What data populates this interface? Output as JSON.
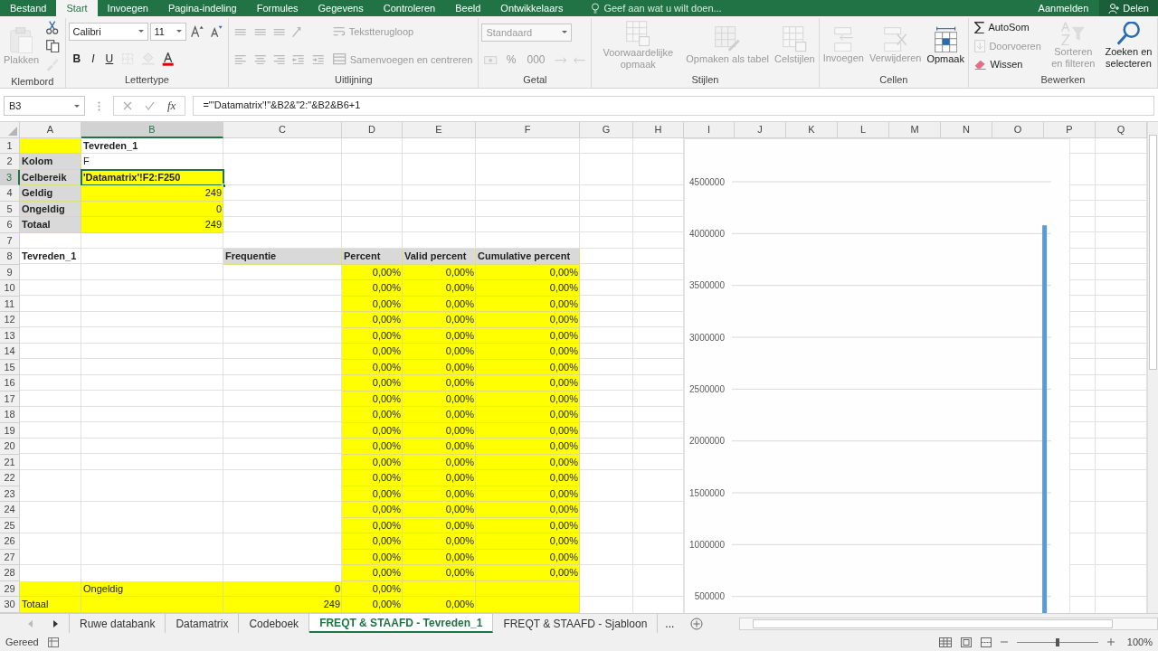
{
  "menu_tabs": [
    {
      "label": "Bestand",
      "selected": false
    },
    {
      "label": "Start",
      "selected": true
    },
    {
      "label": "Invoegen",
      "selected": false
    },
    {
      "label": "Pagina-indeling",
      "selected": false
    },
    {
      "label": "Formules",
      "selected": false
    },
    {
      "label": "Gegevens",
      "selected": false
    },
    {
      "label": "Controleren",
      "selected": false
    },
    {
      "label": "Beeld",
      "selected": false
    },
    {
      "label": "Ontwikkelaars",
      "selected": false
    }
  ],
  "tell_me": {
    "placeholder": "Geef aan wat u wilt doen..."
  },
  "account": {
    "sign_in": "Aanmelden",
    "share": "Delen"
  },
  "ribbon": [
    {
      "label": "Klembord",
      "sections": [
        [
          [
            {
              "kind": "big",
              "label": "Plakken",
              "disabled": true
            }
          ]
        ],
        [
          [
            {
              "kind": "icon",
              "disabled": false
            }
          ],
          [
            {
              "kind": "icon",
              "disabled": false
            }
          ],
          [
            {
              "kind": "icon",
              "disabled": true
            }
          ]
        ]
      ]
    },
    {
      "label": "Lettertype",
      "sections": [
        [
          [
            {
              "kind": "field",
              "value": "Calibri",
              "disabled": false
            },
            {
              "kind": "field",
              "value": "11",
              "disabled": false
            },
            {
              "kind": "icon",
              "disabled": false
            },
            {
              "kind": "icon",
              "disabled": false
            }
          ],
          [
            {
              "kind": "bold",
              "label": "B",
              "disabled": false
            },
            {
              "kind": "italic",
              "label": "I",
              "disabled": false
            },
            {
              "kind": "underline",
              "label": "U",
              "disabled": false
            },
            {
              "kind": "icon",
              "disabled": true
            },
            {
              "kind": "icon",
              "disabled": true
            },
            {
              "kind": "icon",
              "disabled": false
            }
          ]
        ]
      ]
    },
    {
      "label": "Uitlijning",
      "sections": [
        [
          [
            {
              "kind": "icon",
              "disabled": true
            },
            {
              "kind": "icon",
              "disabled": true
            },
            {
              "kind": "icon",
              "disabled": true
            },
            {
              "kind": "icon",
              "disabled": true
            }
          ],
          [
            {
              "kind": "icon",
              "disabled": true
            },
            {
              "kind": "icon",
              "disabled": true
            },
            {
              "kind": "icon",
              "disabled": true
            },
            {
              "kind": "icon",
              "disabled": true
            },
            {
              "kind": "icon",
              "disabled": true
            }
          ]
        ],
        [
          [
            {
              "kind": "small",
              "label": "Tekstterugloop",
              "disabled": true
            }
          ],
          [
            {
              "kind": "small",
              "label": "Samenvoegen en centreren",
              "disabled": true
            }
          ]
        ]
      ]
    },
    {
      "label": "Getal",
      "sections": [
        [
          [
            {
              "kind": "field",
              "value": "Standaard",
              "disabled": true
            }
          ],
          [
            {
              "kind": "icon",
              "disabled": true
            },
            {
              "kind": "text",
              "label": "%",
              "disabled": true
            },
            {
              "kind": "text",
              "label": "000",
              "disabled": true
            },
            {
              "kind": "icon",
              "disabled": true
            },
            {
              "kind": "icon",
              "disabled": true
            }
          ]
        ]
      ]
    },
    {
      "label": "Stijlen",
      "sections": [
        [
          [
            {
              "kind": "big",
              "label": "Voorwaardelijke opmaak",
              "disabled": true
            }
          ]
        ],
        [
          [
            {
              "kind": "big",
              "label": "Opmaken als tabel",
              "disabled": true
            }
          ]
        ],
        [
          [
            {
              "kind": "big",
              "label": "Celstijlen",
              "disabled": true
            }
          ]
        ]
      ]
    },
    {
      "label": "Cellen",
      "sections": [
        [
          [
            {
              "kind": "big",
              "label": "Invoegen",
              "disabled": true
            }
          ]
        ],
        [
          [
            {
              "kind": "big",
              "label": "Verwijderen",
              "disabled": true
            }
          ]
        ],
        [
          [
            {
              "kind": "big",
              "label": "Opmaak",
              "disabled": false
            }
          ]
        ]
      ]
    },
    {
      "label": "Bewerken",
      "sections": [
        [
          [
            {
              "kind": "small",
              "label": "AutoSom",
              "disabled": false
            }
          ],
          [
            {
              "kind": "small",
              "label": "Doorvoeren",
              "disabled": true
            }
          ],
          [
            {
              "kind": "small",
              "label": "Wissen",
              "disabled": false
            }
          ]
        ],
        [
          [
            {
              "kind": "big",
              "label": "Sorteren en filteren",
              "disabled": true
            }
          ]
        ],
        [
          [
            {
              "kind": "big",
              "label": "Zoeken en selecteren",
              "disabled": false
            }
          ]
        ]
      ]
    }
  ],
  "formula_bar": {
    "name_box": "B3",
    "function_label": "fx",
    "formula": "=\"'Datamatrix'!\"&B2&\"2:\"&B2&B6+1"
  },
  "columns": [
    {
      "label": "A",
      "selected": false
    },
    {
      "label": "B",
      "selected": true
    },
    {
      "label": "C",
      "selected": false
    },
    {
      "label": "D",
      "selected": false
    },
    {
      "label": "E",
      "selected": false
    },
    {
      "label": "F",
      "selected": false
    },
    {
      "label": "G",
      "selected": false
    },
    {
      "label": "H",
      "selected": false
    },
    {
      "label": "I",
      "selected": false
    },
    {
      "label": "J",
      "selected": false
    },
    {
      "label": "K",
      "selected": false
    },
    {
      "label": "L",
      "selected": false
    },
    {
      "label": "M",
      "selected": false
    },
    {
      "label": "N",
      "selected": false
    },
    {
      "label": "O",
      "selected": false
    },
    {
      "label": "P",
      "selected": false
    },
    {
      "label": "Q",
      "selected": false
    }
  ],
  "rows": [
    {
      "label": "1",
      "selected": false,
      "cells": [
        {
          "color": "#ffff00"
        },
        {
          "text": "Tevreden_1",
          "kind": "text",
          "bold": true
        }
      ]
    },
    {
      "label": "2",
      "selected": false,
      "cells": [
        {
          "text": "Kolom",
          "kind": "text",
          "bold": true,
          "color": "#d9d9d9"
        },
        {
          "text": "F",
          "kind": "text",
          "bold": false
        }
      ]
    },
    {
      "label": "3",
      "selected": true,
      "cells": [
        {
          "text": "Celbereik",
          "kind": "text",
          "bold": true,
          "color": "#d9d9d9"
        },
        {
          "text": "'Datamatrix'!F2:F250",
          "kind": "text",
          "bold": true,
          "color": "#ffff00"
        }
      ]
    },
    {
      "label": "4",
      "selected": false,
      "cells": [
        {
          "text": "Geldig",
          "kind": "text",
          "bold": true,
          "color": "#d9d9d9"
        },
        {
          "text": "249",
          "kind": "number",
          "bold": false,
          "color": "#ffff00"
        }
      ]
    },
    {
      "label": "5",
      "selected": false,
      "cells": [
        {
          "text": "Ongeldig",
          "kind": "text",
          "bold": true,
          "color": "#d9d9d9"
        },
        {
          "text": "0",
          "kind": "number",
          "bold": false,
          "color": "#ffff00"
        }
      ]
    },
    {
      "label": "6",
      "selected": false,
      "cells": [
        {
          "text": "Totaal",
          "kind": "text",
          "bold": true,
          "color": "#d9d9d9"
        },
        {
          "text": "249",
          "kind": "number",
          "bold": false,
          "color": "#ffff00"
        }
      ]
    },
    {
      "label": "7",
      "selected": false,
      "cells": []
    },
    {
      "label": "8",
      "selected": false,
      "cells": [
        {
          "text": "Tevreden_1",
          "kind": "text",
          "bold": true
        },
        {},
        {
          "text": "Frequentie",
          "kind": "text",
          "bold": true,
          "color": "#d9d9d9"
        },
        {
          "text": "Percent",
          "kind": "text",
          "bold": true,
          "color": "#d9d9d9"
        },
        {
          "text": "Valid percent",
          "kind": "text",
          "bold": true,
          "color": "#d9d9d9"
        },
        {
          "text": "Cumulative percent",
          "kind": "text",
          "bold": true,
          "color": "#d9d9d9"
        }
      ]
    },
    {
      "label": "9",
      "selected": false,
      "cells": [
        {},
        {},
        {},
        {
          "text": "0,00%",
          "kind": "number",
          "bold": false,
          "color": "#ffff00"
        },
        {
          "text": "0,00%",
          "kind": "number",
          "bold": false,
          "color": "#ffff00"
        },
        {
          "text": "0,00%",
          "kind": "number",
          "bold": false,
          "color": "#ffff00"
        }
      ]
    },
    {
      "label": "10",
      "selected": false,
      "cells": [
        {},
        {},
        {},
        {
          "text": "0,00%",
          "kind": "number",
          "bold": false,
          "color": "#ffff00"
        },
        {
          "text": "0,00%",
          "kind": "number",
          "bold": false,
          "color": "#ffff00"
        },
        {
          "text": "0,00%",
          "kind": "number",
          "bold": false,
          "color": "#ffff00"
        }
      ]
    },
    {
      "label": "11",
      "selected": false,
      "cells": [
        {},
        {},
        {},
        {
          "text": "0,00%",
          "kind": "number",
          "bold": false,
          "color": "#ffff00"
        },
        {
          "text": "0,00%",
          "kind": "number",
          "bold": false,
          "color": "#ffff00"
        },
        {
          "text": "0,00%",
          "kind": "number",
          "bold": false,
          "color": "#ffff00"
        }
      ]
    },
    {
      "label": "12",
      "selected": false,
      "cells": [
        {},
        {},
        {},
        {
          "text": "0,00%",
          "kind": "number",
          "bold": false,
          "color": "#ffff00"
        },
        {
          "text": "0,00%",
          "kind": "number",
          "bold": false,
          "color": "#ffff00"
        },
        {
          "text": "0,00%",
          "kind": "number",
          "bold": false,
          "color": "#ffff00"
        }
      ]
    },
    {
      "label": "13",
      "selected": false,
      "cells": [
        {},
        {},
        {},
        {
          "text": "0,00%",
          "kind": "number",
          "bold": false,
          "color": "#ffff00"
        },
        {
          "text": "0,00%",
          "kind": "number",
          "bold": false,
          "color": "#ffff00"
        },
        {
          "text": "0,00%",
          "kind": "number",
          "bold": false,
          "color": "#ffff00"
        }
      ]
    },
    {
      "label": "14",
      "selected": false,
      "cells": [
        {},
        {},
        {},
        {
          "text": "0,00%",
          "kind": "number",
          "bold": false,
          "color": "#ffff00"
        },
        {
          "text": "0,00%",
          "kind": "number",
          "bold": false,
          "color": "#ffff00"
        },
        {
          "text": "0,00%",
          "kind": "number",
          "bold": false,
          "color": "#ffff00"
        }
      ]
    },
    {
      "label": "15",
      "selected": false,
      "cells": [
        {},
        {},
        {},
        {
          "text": "0,00%",
          "kind": "number",
          "bold": false,
          "color": "#ffff00"
        },
        {
          "text": "0,00%",
          "kind": "number",
          "bold": false,
          "color": "#ffff00"
        },
        {
          "text": "0,00%",
          "kind": "number",
          "bold": false,
          "color": "#ffff00"
        }
      ]
    },
    {
      "label": "16",
      "selected": false,
      "cells": [
        {},
        {},
        {},
        {
          "text": "0,00%",
          "kind": "number",
          "bold": false,
          "color": "#ffff00"
        },
        {
          "text": "0,00%",
          "kind": "number",
          "bold": false,
          "color": "#ffff00"
        },
        {
          "text": "0,00%",
          "kind": "number",
          "bold": false,
          "color": "#ffff00"
        }
      ]
    },
    {
      "label": "17",
      "selected": false,
      "cells": [
        {},
        {},
        {},
        {
          "text": "0,00%",
          "kind": "number",
          "bold": false,
          "color": "#ffff00"
        },
        {
          "text": "0,00%",
          "kind": "number",
          "bold": false,
          "color": "#ffff00"
        },
        {
          "text": "0,00%",
          "kind": "number",
          "bold": false,
          "color": "#ffff00"
        }
      ]
    },
    {
      "label": "18",
      "selected": false,
      "cells": [
        {},
        {},
        {},
        {
          "text": "0,00%",
          "kind": "number",
          "bold": false,
          "color": "#ffff00"
        },
        {
          "text": "0,00%",
          "kind": "number",
          "bold": false,
          "color": "#ffff00"
        },
        {
          "text": "0,00%",
          "kind": "number",
          "bold": false,
          "color": "#ffff00"
        }
      ]
    },
    {
      "label": "19",
      "selected": false,
      "cells": [
        {},
        {},
        {},
        {
          "text": "0,00%",
          "kind": "number",
          "bold": false,
          "color": "#ffff00"
        },
        {
          "text": "0,00%",
          "kind": "number",
          "bold": false,
          "color": "#ffff00"
        },
        {
          "text": "0,00%",
          "kind": "number",
          "bold": false,
          "color": "#ffff00"
        }
      ]
    },
    {
      "label": "20",
      "selected": false,
      "cells": [
        {},
        {},
        {},
        {
          "text": "0,00%",
          "kind": "number",
          "bold": false,
          "color": "#ffff00"
        },
        {
          "text": "0,00%",
          "kind": "number",
          "bold": false,
          "color": "#ffff00"
        },
        {
          "text": "0,00%",
          "kind": "number",
          "bold": false,
          "color": "#ffff00"
        }
      ]
    },
    {
      "label": "21",
      "selected": false,
      "cells": [
        {},
        {},
        {},
        {
          "text": "0,00%",
          "kind": "number",
          "bold": false,
          "color": "#ffff00"
        },
        {
          "text": "0,00%",
          "kind": "number",
          "bold": false,
          "color": "#ffff00"
        },
        {
          "text": "0,00%",
          "kind": "number",
          "bold": false,
          "color": "#ffff00"
        }
      ]
    },
    {
      "label": "22",
      "selected": false,
      "cells": [
        {},
        {},
        {},
        {
          "text": "0,00%",
          "kind": "number",
          "bold": false,
          "color": "#ffff00"
        },
        {
          "text": "0,00%",
          "kind": "number",
          "bold": false,
          "color": "#ffff00"
        },
        {
          "text": "0,00%",
          "kind": "number",
          "bold": false,
          "color": "#ffff00"
        }
      ]
    },
    {
      "label": "23",
      "selected": false,
      "cells": [
        {},
        {},
        {},
        {
          "text": "0,00%",
          "kind": "number",
          "bold": false,
          "color": "#ffff00"
        },
        {
          "text": "0,00%",
          "kind": "number",
          "bold": false,
          "color": "#ffff00"
        },
        {
          "text": "0,00%",
          "kind": "number",
          "bold": false,
          "color": "#ffff00"
        }
      ]
    },
    {
      "label": "24",
      "selected": false,
      "cells": [
        {},
        {},
        {},
        {
          "text": "0,00%",
          "kind": "number",
          "bold": false,
          "color": "#ffff00"
        },
        {
          "text": "0,00%",
          "kind": "number",
          "bold": false,
          "color": "#ffff00"
        },
        {
          "text": "0,00%",
          "kind": "number",
          "bold": false,
          "color": "#ffff00"
        }
      ]
    },
    {
      "label": "25",
      "selected": false,
      "cells": [
        {},
        {},
        {},
        {
          "text": "0,00%",
          "kind": "number",
          "bold": false,
          "color": "#ffff00"
        },
        {
          "text": "0,00%",
          "kind": "number",
          "bold": false,
          "color": "#ffff00"
        },
        {
          "text": "0,00%",
          "kind": "number",
          "bold": false,
          "color": "#ffff00"
        }
      ]
    },
    {
      "label": "26",
      "selected": false,
      "cells": [
        {},
        {},
        {},
        {
          "text": "0,00%",
          "kind": "number",
          "bold": false,
          "color": "#ffff00"
        },
        {
          "text": "0,00%",
          "kind": "number",
          "bold": false,
          "color": "#ffff00"
        },
        {
          "text": "0,00%",
          "kind": "number",
          "bold": false,
          "color": "#ffff00"
        }
      ]
    },
    {
      "label": "27",
      "selected": false,
      "cells": [
        {},
        {},
        {},
        {
          "text": "0,00%",
          "kind": "number",
          "bold": false,
          "color": "#ffff00"
        },
        {
          "text": "0,00%",
          "kind": "number",
          "bold": false,
          "color": "#ffff00"
        },
        {
          "text": "0,00%",
          "kind": "number",
          "bold": false,
          "color": "#ffff00"
        }
      ]
    },
    {
      "label": "28",
      "selected": false,
      "cells": [
        {},
        {},
        {},
        {
          "text": "0,00%",
          "kind": "number",
          "bold": false,
          "color": "#ffff00"
        },
        {
          "text": "0,00%",
          "kind": "number",
          "bold": false,
          "color": "#ffff00"
        },
        {
          "text": "0,00%",
          "kind": "number",
          "bold": false,
          "color": "#ffff00"
        }
      ]
    },
    {
      "label": "29",
      "selected": false,
      "cells": [
        {
          "color": "#ffff00"
        },
        {
          "text": "Ongeldig",
          "kind": "text",
          "bold": false,
          "color": "#ffff00"
        },
        {
          "text": "0",
          "kind": "number",
          "bold": false,
          "color": "#ffff00"
        },
        {
          "text": "0,00%",
          "kind": "number",
          "bold": false,
          "color": "#ffff00"
        },
        {
          "color": "#ffff00"
        },
        {
          "color": "#ffff00"
        }
      ]
    },
    {
      "label": "30",
      "selected": false,
      "cells": [
        {
          "text": "Totaal",
          "kind": "text",
          "bold": false,
          "color": "#ffff00"
        },
        {
          "color": "#ffff00"
        },
        {
          "text": "249",
          "kind": "number",
          "bold": false,
          "color": "#ffff00"
        },
        {
          "text": "0,00%",
          "kind": "number",
          "bold": false,
          "color": "#ffff00"
        },
        {
          "text": "0,00%",
          "kind": "number",
          "bold": false,
          "color": "#ffff00"
        },
        {
          "color": "#ffff00"
        }
      ]
    }
  ],
  "chart": {
    "chart_data": {
      "type": "bar",
      "ylim": [
        0,
        4500000
      ],
      "grid": true,
      "yticks": [
        500000,
        1000000,
        1500000,
        2000000,
        2500000,
        3000000,
        3500000,
        4000000,
        4500000
      ],
      "series": [
        {
          "color": "#5b9bd5",
          "values": [
            null,
            null,
            null,
            null,
            null,
            null,
            null,
            null,
            null,
            null,
            null,
            null,
            null,
            null,
            null,
            null,
            null,
            null,
            null,
            null,
            null,
            null,
            null,
            4080000
          ]
        }
      ]
    }
  },
  "sheet_tabs": [
    {
      "label": "Ruwe databank",
      "selected": false
    },
    {
      "label": "Datamatrix",
      "selected": false
    },
    {
      "label": "Codeboek",
      "selected": false
    },
    {
      "label": "FREQT & STAAFD - Tevreden_1",
      "selected": true
    },
    {
      "label": "FREQT & STAAFD - Sjabloon",
      "selected": false
    }
  ],
  "more_tabs": "...",
  "status_bar": {
    "status": "Gereed",
    "zoom": {
      "level": 0.5,
      "reading": "100%"
    }
  }
}
